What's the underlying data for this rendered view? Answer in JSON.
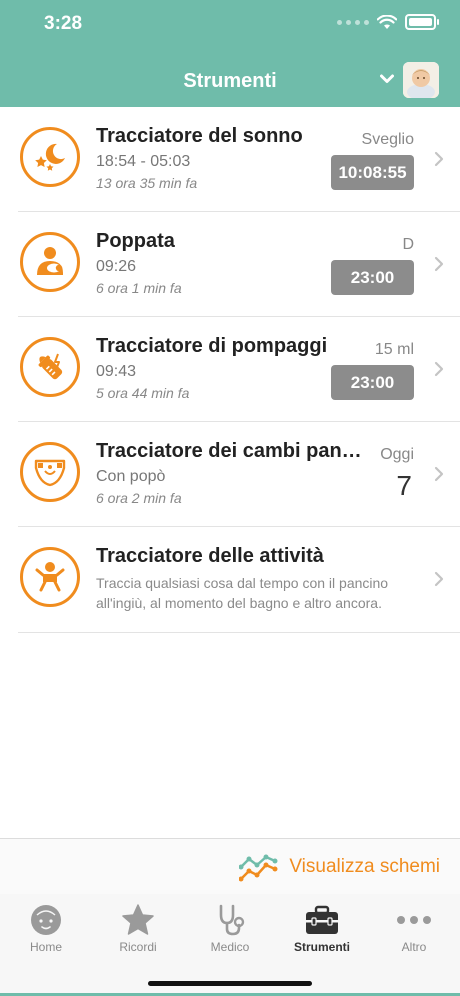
{
  "status_bar": {
    "time": "3:28"
  },
  "header": {
    "title": "Strumenti"
  },
  "trackers": [
    {
      "title": "Tracciatore del sonno",
      "subtitle": "18:54 - 05:03",
      "ago": "13 ora 35 min fa",
      "right_label": "Sveglio",
      "timer": "10:08:55",
      "icon": "sleep-moon-stars-icon"
    },
    {
      "title": "Poppata",
      "subtitle": "09:26",
      "ago": "6 ora 1 min fa",
      "right_label": "D",
      "timer": "23:00",
      "icon": "breastfeeding-icon"
    },
    {
      "title": "Tracciatore di pompaggi",
      "subtitle": "09:43",
      "ago": "5 ora 44 min fa",
      "right_label": "15 ml",
      "timer": "23:00",
      "icon": "baby-bottle-icon"
    },
    {
      "title": "Tracciatore dei cambi pan…",
      "subtitle": "Con popò",
      "ago": "6 ora 2 min fa",
      "right_label": "Oggi",
      "count": "7",
      "icon": "diaper-icon"
    },
    {
      "title": "Tracciatore delle attività",
      "description": "Traccia qualsiasi cosa dal tempo con il pancino all'ingiù, al momento del bagno e altro ancora.",
      "icon": "baby-activity-icon"
    }
  ],
  "charts_link": {
    "label": "Visualizza schemi",
    "icon": "line-chart-icon"
  },
  "tabs": [
    {
      "label": "Home",
      "icon": "baby-face-icon"
    },
    {
      "label": "Ricordi",
      "icon": "star-icon"
    },
    {
      "label": "Medico",
      "icon": "stethoscope-icon"
    },
    {
      "label": "Strumenti",
      "icon": "toolbox-icon",
      "active": true
    },
    {
      "label": "Altro",
      "icon": "more-dots-icon"
    }
  ],
  "colors": {
    "header": "#6fbcaa",
    "accent": "#f08c1e",
    "timer_bg": "#8c8c8c",
    "tab_inactive": "#8a8a8a"
  }
}
